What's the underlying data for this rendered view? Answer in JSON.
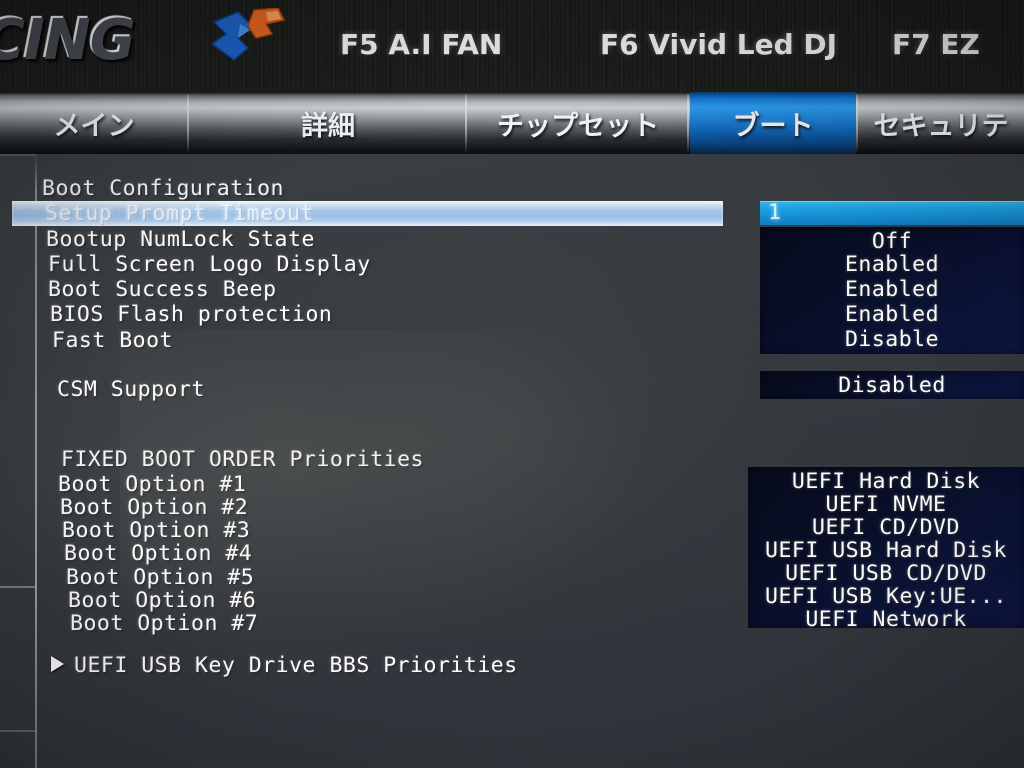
{
  "header": {
    "logo_text": "CING",
    "logo_mark": "racing-chevron-logo",
    "fkeys": [
      {
        "label": "F5 A.I FAN"
      },
      {
        "label": "F6 Vivid Led DJ"
      },
      {
        "label": "F7 EZ"
      }
    ]
  },
  "tabs": [
    {
      "label": "メイン",
      "name": "tab-main",
      "selected": false
    },
    {
      "label": "詳細",
      "name": "tab-advanced",
      "selected": false
    },
    {
      "label": "チップセット",
      "name": "tab-chipset",
      "selected": false
    },
    {
      "label": "ブート",
      "name": "tab-boot",
      "selected": true
    },
    {
      "label": "セキュリテ",
      "name": "tab-security",
      "selected": false
    }
  ],
  "boot_configuration": {
    "section_title": "Boot Configuration",
    "items": [
      {
        "label": "Setup Prompt Timeout",
        "value": "1",
        "selected": true
      },
      {
        "label": "Bootup NumLock State",
        "value": "Off",
        "selected": false
      },
      {
        "label": "Full Screen Logo Display",
        "value": "Enabled",
        "selected": false
      },
      {
        "label": "Boot Success Beep",
        "value": "Enabled",
        "selected": false
      },
      {
        "label": "BIOS Flash protection",
        "value": "Enabled",
        "selected": false
      },
      {
        "label": "Fast Boot",
        "value": "Disable",
        "selected": false
      }
    ]
  },
  "csm": {
    "label": "CSM Support",
    "value": "Disabled"
  },
  "fixed_boot_order": {
    "section_title": "FIXED BOOT ORDER Priorities",
    "items": [
      {
        "label": "Boot Option #1",
        "value": "UEFI Hard Disk"
      },
      {
        "label": "Boot Option #2",
        "value": "UEFI NVME"
      },
      {
        "label": "Boot Option #3",
        "value": "UEFI CD/DVD"
      },
      {
        "label": "Boot Option #4",
        "value": "UEFI USB Hard Disk"
      },
      {
        "label": "Boot Option #5",
        "value": "UEFI USB CD/DVD"
      },
      {
        "label": "Boot Option #6",
        "value": "UEFI USB Key:UE..."
      },
      {
        "label": "Boot Option #7",
        "value": "UEFI Network"
      }
    ]
  },
  "submenus": [
    {
      "label": "UEFI USB Key Drive BBS Priorities",
      "icon": "triangle-right-icon"
    }
  ],
  "colors": {
    "tab_selected": "#1b7fd6",
    "row_highlight": "#a9c8ea",
    "value_panel_bg": "#070d25",
    "value_field_highlight": "#1da2e2",
    "text": "#ffffff"
  }
}
